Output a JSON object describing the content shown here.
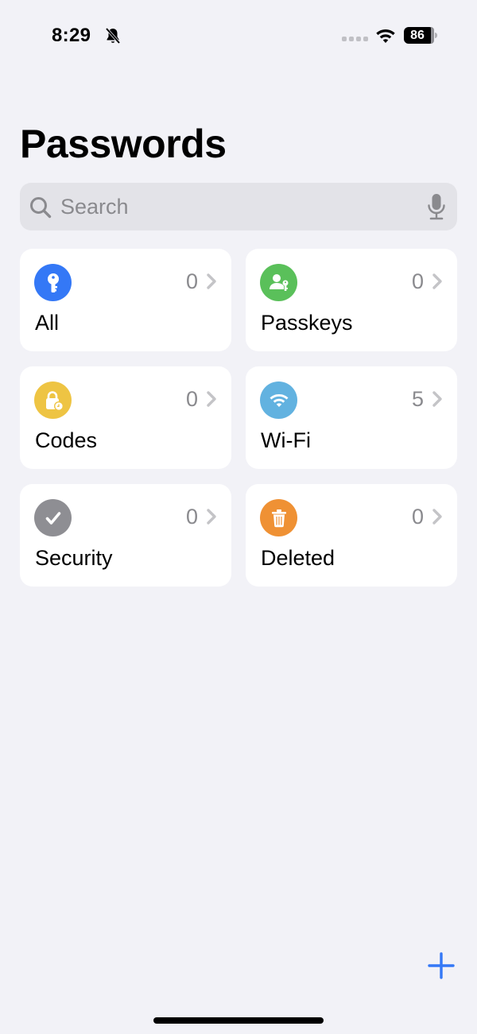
{
  "status_bar": {
    "time": "8:29",
    "silent_icon": "bell-slash-icon",
    "signal_icon": "cellular-signal-dots-icon",
    "wifi_icon": "wifi-icon",
    "battery_level": "86"
  },
  "header": {
    "title": "Passwords"
  },
  "search": {
    "placeholder": "Search",
    "value": "",
    "search_icon": "magnifying-glass-icon",
    "mic_icon": "microphone-icon"
  },
  "categories": [
    {
      "label": "All",
      "count": "0",
      "icon": "key-icon",
      "color": "#3478f6"
    },
    {
      "label": "Passkeys",
      "count": "0",
      "icon": "person-key-icon",
      "color": "#5ac05a"
    },
    {
      "label": "Codes",
      "count": "0",
      "icon": "lock-clock-icon",
      "color": "#eec443"
    },
    {
      "label": "Wi-Fi",
      "count": "5",
      "icon": "wifi-icon",
      "color": "#62b2e0"
    },
    {
      "label": "Security",
      "count": "0",
      "icon": "checkmark-icon",
      "color": "#8e8e93"
    },
    {
      "label": "Deleted",
      "count": "0",
      "icon": "trash-icon",
      "color": "#ef9134"
    }
  ],
  "toolbar": {
    "add_icon": "plus-icon",
    "accent_color": "#3478f6"
  }
}
